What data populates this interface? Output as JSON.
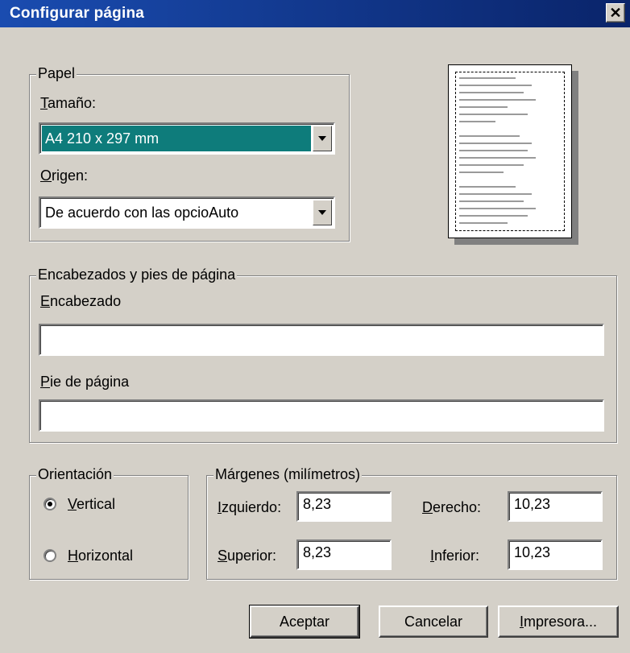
{
  "window": {
    "title": "Configurar página"
  },
  "paper": {
    "legend": "Papel",
    "size_label": "Tamaño:",
    "size_value": "A4 210 x 297 mm",
    "source_label": "Origen:",
    "source_value": "De acuerdo con las opcioAuto"
  },
  "headers": {
    "legend": "Encabezados y pies de página",
    "header_label": "Encabezado",
    "header_value": "",
    "footer_label": "Pie de página",
    "footer_value": ""
  },
  "orientation": {
    "legend": "Orientación",
    "options": [
      {
        "label": "Vertical",
        "selected": true
      },
      {
        "label": "Horizontal",
        "selected": false
      }
    ]
  },
  "margins": {
    "legend": "Márgenes (milímetros)",
    "left_label": "Izquierdo:",
    "left_value": "8,23",
    "right_label": "Derecho:",
    "right_value": "10,23",
    "top_label": "Superior:",
    "top_value": "8,23",
    "bottom_label": "Inferior:",
    "bottom_value": "10,23"
  },
  "buttons": {
    "ok": "Aceptar",
    "cancel": "Cancelar",
    "printer": "Impresora..."
  },
  "colors": {
    "titlebar": "#0a246a",
    "selection": "#0e7c7b",
    "face": "#d4d0c8"
  }
}
